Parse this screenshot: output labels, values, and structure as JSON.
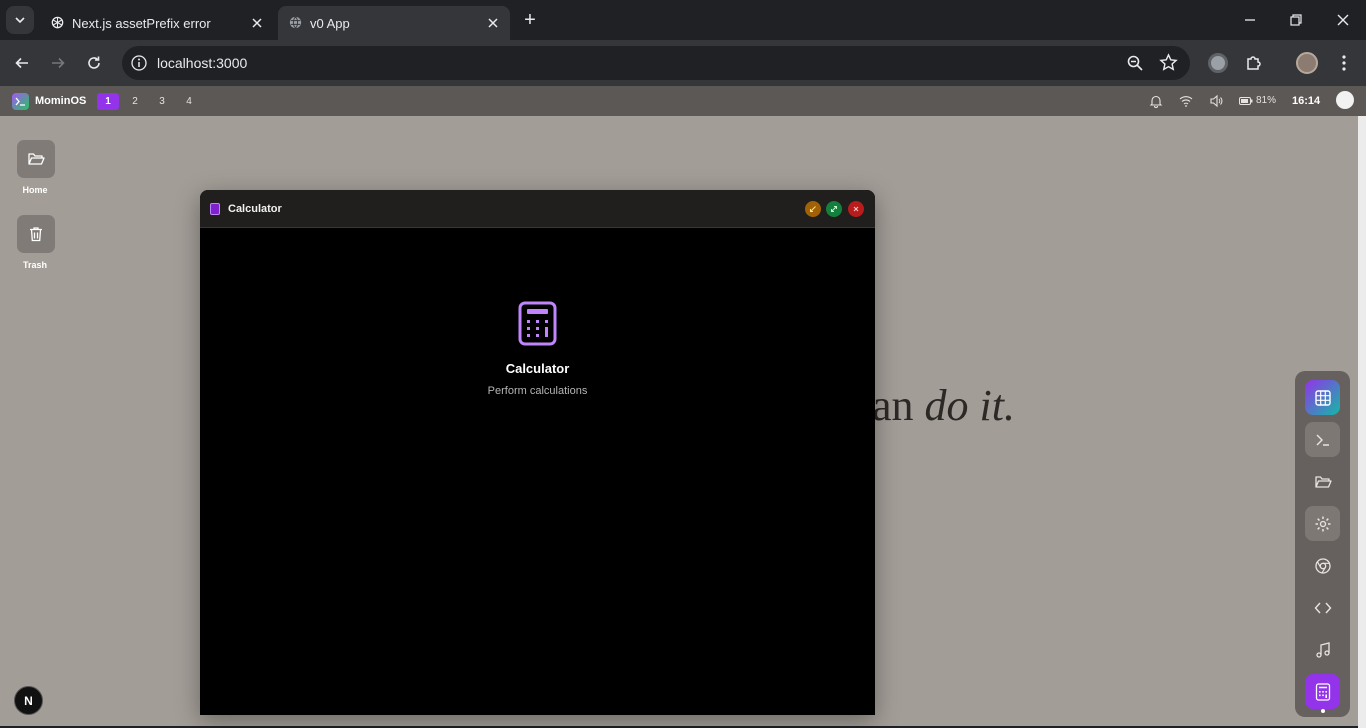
{
  "browser": {
    "tabs": [
      {
        "title": "Next.js assetPrefix error",
        "icon": "openai-icon"
      },
      {
        "title": "v0 App",
        "icon": "globe-icon"
      }
    ],
    "address": "localhost:3000",
    "new_tab_symbol": "+"
  },
  "os_bar": {
    "brand": "MominOS",
    "workspaces": [
      "1",
      "2",
      "3",
      "4"
    ],
    "active_workspace": "1",
    "battery": "81%",
    "time": "16:14"
  },
  "desktop": {
    "icons": [
      {
        "label": "Home",
        "icon": "folder-icon"
      },
      {
        "label": "Trash",
        "icon": "trash-icon"
      }
    ],
    "background_text": {
      "plain": "an ",
      "italic": "do it."
    }
  },
  "window": {
    "title": "Calculator",
    "app_name": "Calculator",
    "app_description": "Perform calculations"
  },
  "dock": {
    "items": [
      "grid-icon",
      "terminal-icon",
      "folder-icon",
      "settings-icon",
      "chrome-icon",
      "code-icon",
      "music-icon",
      "calculator-icon"
    ],
    "active": "calculator-icon"
  },
  "nextjs_badge": "N",
  "colors": {
    "accent": "#9333ea",
    "window_bg": "#000000",
    "desktop_bg": "#a39d97"
  }
}
